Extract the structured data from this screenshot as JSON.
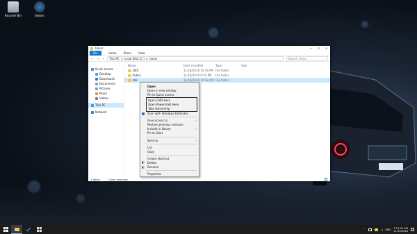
{
  "desktop": {
    "icons": [
      {
        "label": "Recycle Bin",
        "icon": "recycle-bin-icon"
      },
      {
        "label": "Steam",
        "icon": "steam-icon"
      }
    ]
  },
  "window": {
    "title": "Users",
    "controls": {
      "minimize": "—",
      "maximize": "☐",
      "close": "✕"
    },
    "ribbon_tabs": [
      "File",
      "Home",
      "Share",
      "View"
    ],
    "address": {
      "back": "←",
      "forward": "→",
      "up": "↑",
      "path": [
        "This PC",
        "Local Disk (C:)",
        "Users"
      ],
      "sep": ">"
    },
    "search_placeholder": "Search Users",
    "nav": [
      {
        "label": "Quick access",
        "icon": "star-icon",
        "indent": false
      },
      {
        "label": "Desktop",
        "icon": "desktop-icon",
        "indent": true
      },
      {
        "label": "Downloads",
        "icon": "download-icon",
        "indent": true
      },
      {
        "label": "Documents",
        "icon": "documents-icon",
        "indent": true
      },
      {
        "label": "Pictures",
        "icon": "pictures-icon",
        "indent": true
      },
      {
        "label": "Music",
        "icon": "music-icon",
        "indent": true
      },
      {
        "label": "Videos",
        "icon": "videos-icon",
        "indent": true
      },
      {
        "label": "This PC",
        "icon": "computer-icon",
        "indent": false,
        "selected": true
      },
      {
        "label": "Network",
        "icon": "network-icon",
        "indent": false
      }
    ],
    "columns": {
      "name": "Name",
      "date": "Date modified",
      "type": "Type",
      "size": "Size"
    },
    "rows": [
      {
        "name": "DEV",
        "date": "11/18/2018 10:18 PM",
        "type": "File folder",
        "size": ""
      },
      {
        "name": "Public",
        "date": "11/18/2018 9:59 PM",
        "type": "File folder",
        "size": ""
      },
      {
        "name": "Usr",
        "date": "11/18/2018 10:28 AM",
        "type": "File folder",
        "size": ""
      }
    ],
    "status": {
      "items": "3 items",
      "selected": "1 item selected"
    }
  },
  "context_menu": {
    "group1": [
      "Open",
      "Open in new window",
      "Pin to Quick access"
    ],
    "boxed": [
      "Open CMD Here",
      "Open Powershell Here",
      "Take Ownership"
    ],
    "group2": [
      "Scan with Windows Defender..."
    ],
    "group3": [
      {
        "label": "Give access to",
        "submenu": true
      },
      {
        "label": "Restore previous versions",
        "submenu": false
      },
      {
        "label": "Include in library",
        "submenu": true
      },
      {
        "label": "Pin to Start",
        "submenu": false
      }
    ],
    "group4": [
      {
        "label": "Send to",
        "submenu": true
      }
    ],
    "group5": [
      "Cut",
      "Copy"
    ],
    "group6": [
      "Create shortcut",
      "Delete",
      "Rename"
    ],
    "group7": [
      "Properties"
    ]
  },
  "taskbar": {
    "tray": {
      "lang": "ENG",
      "time": "7:21:41 AM",
      "date": "11/19/2018"
    }
  },
  "colors": {
    "accent": "#1979ca",
    "selection": "#cce8ff",
    "folder": "#f0c75e"
  }
}
